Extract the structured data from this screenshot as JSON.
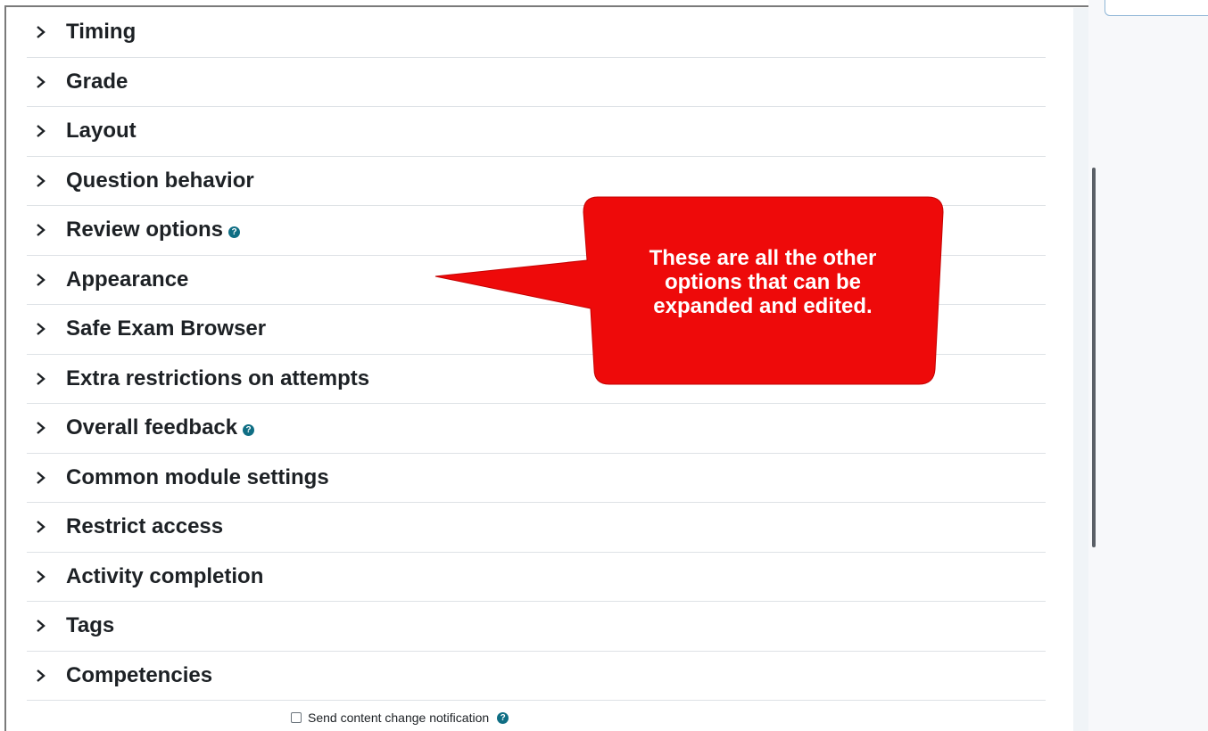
{
  "sections": [
    {
      "label": "Timing",
      "help": false
    },
    {
      "label": "Grade",
      "help": false
    },
    {
      "label": "Layout",
      "help": false
    },
    {
      "label": "Question behavior",
      "help": false
    },
    {
      "label": "Review options",
      "help": true
    },
    {
      "label": "Appearance",
      "help": false
    },
    {
      "label": "Safe Exam Browser",
      "help": false
    },
    {
      "label": "Extra restrictions on attempts",
      "help": false
    },
    {
      "label": "Overall feedback",
      "help": true
    },
    {
      "label": "Common module settings",
      "help": false
    },
    {
      "label": "Restrict access",
      "help": false
    },
    {
      "label": "Activity completion",
      "help": false
    },
    {
      "label": "Tags",
      "help": false
    },
    {
      "label": "Competencies",
      "help": false
    }
  ],
  "notification": {
    "label": "Send content change notification",
    "checked": false
  },
  "callout": {
    "line1": "These are all the other",
    "line2": "options that can be",
    "line3": "expanded and edited.",
    "color": "#ee0a0a"
  },
  "icons": {
    "chevron": "chevron-right-icon",
    "help": "question-circle-icon"
  },
  "accent": "#0f6e84"
}
